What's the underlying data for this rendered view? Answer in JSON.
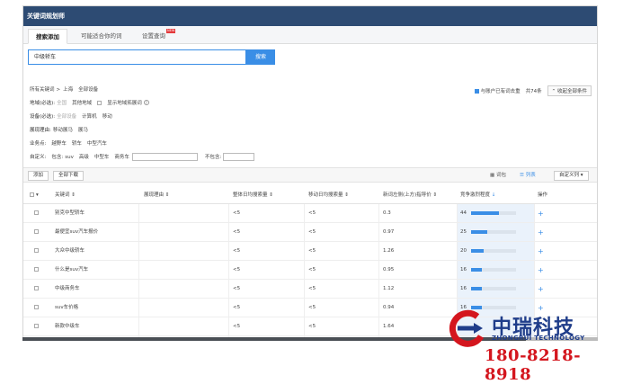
{
  "window": {
    "title": "关键词规划师"
  },
  "tabs": [
    {
      "label": "搜索添加"
    },
    {
      "label": "可能适合你的词"
    },
    {
      "label": "设置查询",
      "badge": "NEW"
    }
  ],
  "search": {
    "value": "中级轿车",
    "button": "搜索"
  },
  "breadcrumb": {
    "root": "所有关键词",
    "sep": ">",
    "item1": "上海",
    "item2": "全部设备"
  },
  "filters": {
    "region_label": "地域(必选):",
    "region_opt1": "全国",
    "region_opt2": "其他地域",
    "region_check": "显示地域拓展词",
    "device_label": "设备(必选):",
    "device_opt1": "全部设备",
    "device_opt2": "计算机",
    "device_opt3": "移动",
    "reason_label": "展现理由:",
    "reason_opt1": "移动展马",
    "reason_opt2": "展马",
    "business_label": "业务点:",
    "business_opt1": "越野车",
    "business_opt2": "轿车",
    "business_opt3": "中型汽车",
    "custom_label": "自定义:",
    "include_label": "包含:",
    "include_opt1": "suv",
    "include_opt2": "高级",
    "include_opt3": "中型车",
    "include_opt4": "商务车",
    "exclude_label": "不包含:"
  },
  "right_info": {
    "check_label": "与账户已有词去重",
    "count": "共74条",
    "collapse": "收起全部条件"
  },
  "toolbar": {
    "add": "添加",
    "download": "全部下载",
    "view_word": "词包",
    "view_list": "列表",
    "custom_col": "自定义列"
  },
  "table": {
    "headers": [
      "关键词",
      "展现理由",
      "整体日均搜索量",
      "移动日均搜索量",
      "新词左侧(上方)指导价",
      "竞争激烈程度",
      "操作"
    ],
    "rows": [
      {
        "keyword": "别克中型轿车",
        "reason": "",
        "total": "<5",
        "mobile": "<5",
        "price": "0.3",
        "comp": "44",
        "comp_pct": 0.62,
        "op": "+"
      },
      {
        "keyword": "最便宜suv汽车报价",
        "reason": "",
        "total": "<5",
        "mobile": "<5",
        "price": "0.97",
        "comp": "25",
        "comp_pct": 0.35,
        "op": "+"
      },
      {
        "keyword": "大众中级轿车",
        "reason": "",
        "total": "<5",
        "mobile": "<5",
        "price": "1.26",
        "comp": "20",
        "comp_pct": 0.28,
        "op": "+"
      },
      {
        "keyword": "什么是suv汽车",
        "reason": "",
        "total": "<5",
        "mobile": "<5",
        "price": "0.95",
        "comp": "16",
        "comp_pct": 0.24,
        "op": "+"
      },
      {
        "keyword": "中级商务车",
        "reason": "",
        "total": "<5",
        "mobile": "<5",
        "price": "1.12",
        "comp": "16",
        "comp_pct": 0.24,
        "op": "+"
      },
      {
        "keyword": "suv车价格",
        "reason": "",
        "total": "<5",
        "mobile": "<5",
        "price": "0.94",
        "comp": "16",
        "comp_pct": 0.24,
        "op": "+"
      },
      {
        "keyword": "新款中级车",
        "reason": "",
        "total": "<5",
        "mobile": "<5",
        "price": "1.64",
        "comp": "",
        "comp_pct": 0,
        "op": ""
      }
    ]
  },
  "logo": {
    "name": "中瑞科技",
    "name_en": "ZHONGRUI TECHNOLOGY",
    "phone": "180-8218-8918"
  },
  "colors": {
    "accent": "#3a8ee6",
    "titlebar": "#2d4b73",
    "brand_blue": "#1f3d8a",
    "brand_red": "#d4161e"
  }
}
